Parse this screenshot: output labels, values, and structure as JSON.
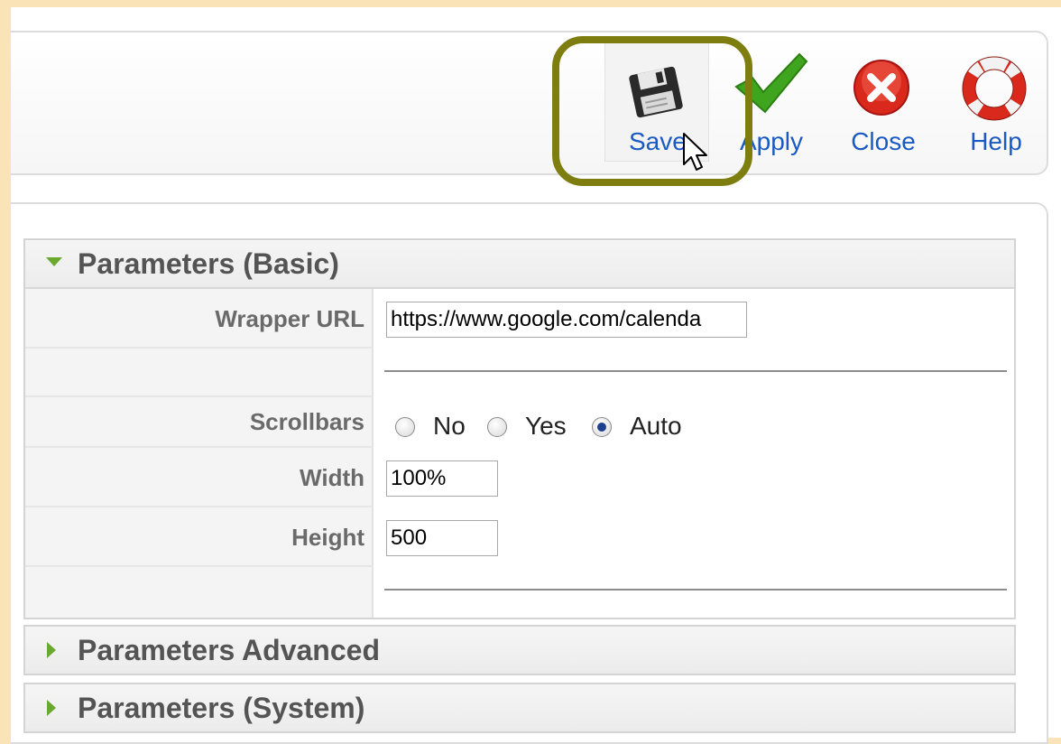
{
  "toolbar": {
    "save_label": "Save",
    "apply_label": "Apply",
    "close_label": "Close",
    "help_label": "Help"
  },
  "panels": {
    "basic": {
      "title": "Parameters (Basic)",
      "expanded": true,
      "fields": {
        "wrapper_url": {
          "label": "Wrapper URL",
          "value": "https://www.google.com/calenda"
        },
        "scrollbars": {
          "label": "Scrollbars",
          "options": [
            "No",
            "Yes",
            "Auto"
          ],
          "selected": "Auto"
        },
        "width": {
          "label": "Width",
          "value": "100%"
        },
        "height": {
          "label": "Height",
          "value": "500"
        }
      }
    },
    "advanced": {
      "title": "Parameters Advanced",
      "expanded": false
    },
    "system": {
      "title": "Parameters (System)",
      "expanded": false
    }
  },
  "colors": {
    "background": "#fbe3b8",
    "link_blue": "#1a5ac2",
    "highlight": "#7d7d10",
    "arrow_green": "#6aa830"
  }
}
